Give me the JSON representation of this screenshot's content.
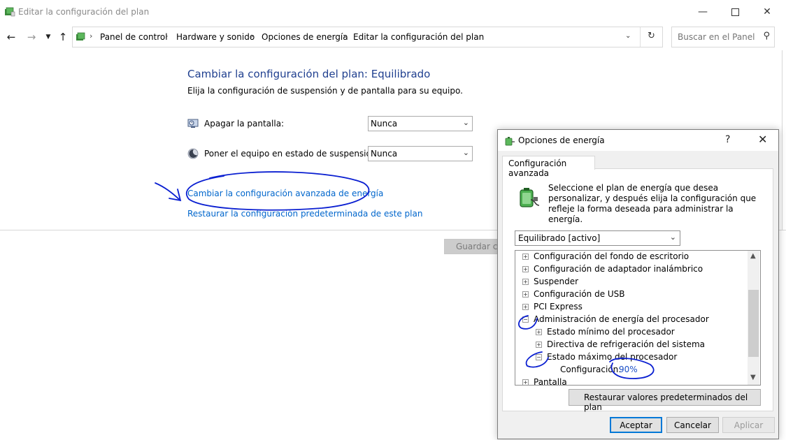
{
  "window": {
    "title": "Editar la configuración del plan",
    "breadcrumb": [
      "Panel de control",
      "Hardware y sonido",
      "Opciones de energía",
      "Editar la configuración del plan"
    ],
    "search_placeholder": "Buscar en el Panel ..."
  },
  "main": {
    "title": "Cambiar la configuración del plan: Equilibrado",
    "subtitle": "Elija la configuración de suspensión y de pantalla para su equipo.",
    "settings": [
      {
        "label": "Apagar la pantalla:",
        "value": "Nunca",
        "icon": "monitor-clock-icon"
      },
      {
        "label": "Poner el equipo en estado de suspensión:",
        "value": "Nunca",
        "icon": "moon-icon"
      }
    ],
    "links": {
      "advanced": "Cambiar la configuración avanzada de energía",
      "restore_defaults": "Restaurar la configuración predeterminada de este plan"
    },
    "save_label": "Guardar ca"
  },
  "dialog": {
    "title": "Opciones de energía",
    "help_label": "?",
    "tab_label": "Configuración avanzada",
    "instructions": "Seleccione el plan de energía que desea personalizar, y después elija la configuración que refleje la forma deseada para administrar la energía.",
    "plan_selected": "Equilibrado [activo]",
    "tree": [
      {
        "label": "Configuración del fondo de escritorio",
        "level": 0,
        "expanded": false
      },
      {
        "label": "Configuración de adaptador inalámbrico",
        "level": 0,
        "expanded": false
      },
      {
        "label": "Suspender",
        "level": 0,
        "expanded": false
      },
      {
        "label": "Configuración de USB",
        "level": 0,
        "expanded": false
      },
      {
        "label": "PCI Express",
        "level": 0,
        "expanded": false
      },
      {
        "label": "Administración de energía del procesador",
        "level": 0,
        "expanded": true
      },
      {
        "label": "Estado mínimo del procesador",
        "level": 1,
        "expanded": false
      },
      {
        "label": "Directiva de refrigeración del sistema",
        "level": 1,
        "expanded": false
      },
      {
        "label": "Estado máximo del procesador",
        "level": 1,
        "expanded": true
      },
      {
        "label": "Configuración:",
        "value": "90%",
        "level": 2
      },
      {
        "label": "Pantalla",
        "level": 0,
        "expanded": false
      }
    ],
    "restore_label": "Restaurar valores predeterminados del plan",
    "buttons": {
      "accept": "Aceptar",
      "cancel": "Cancelar",
      "apply": "Aplicar"
    }
  },
  "colors": {
    "title_blue": "#1f3f8f",
    "link_blue": "#0066cc",
    "ink_blue": "#0a1fd1",
    "value_blue": "#1a4fc7"
  }
}
